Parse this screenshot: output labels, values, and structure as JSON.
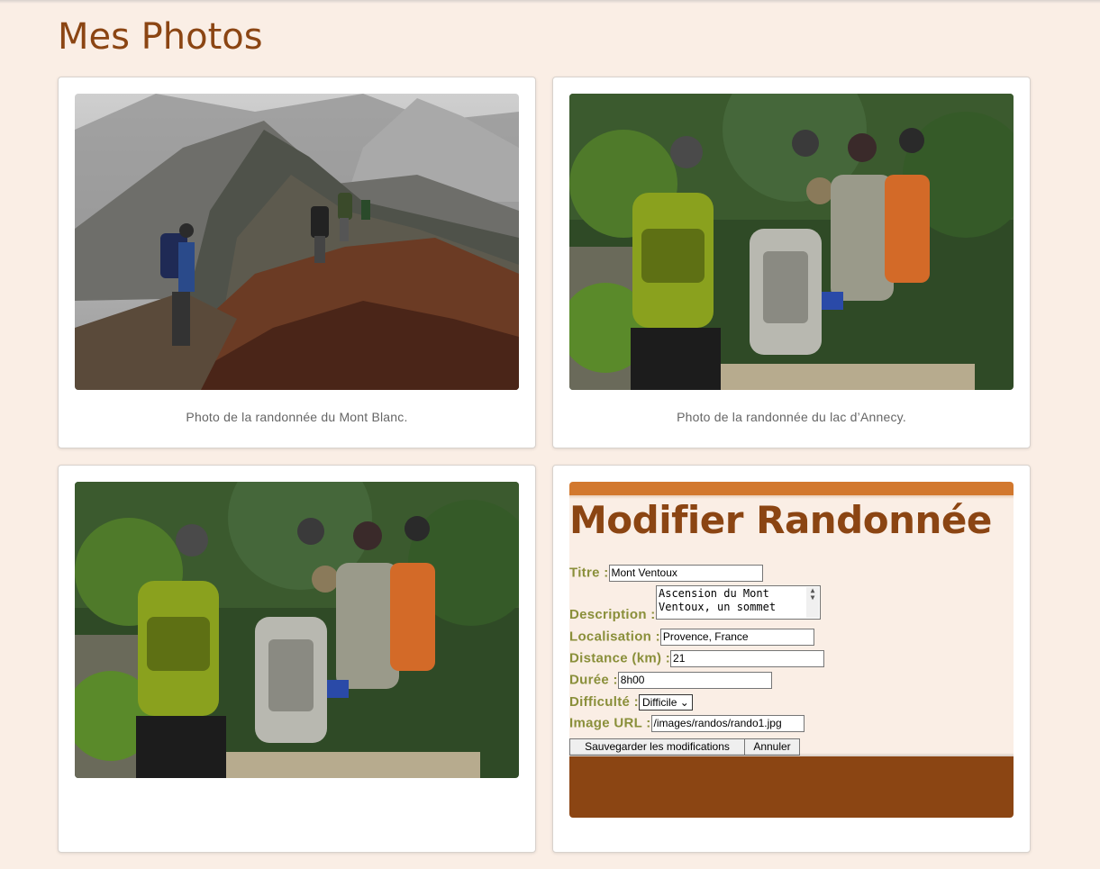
{
  "page": {
    "title": "Mes Photos"
  },
  "cards": [
    {
      "caption": "Photo de la randonnée du Mont Blanc."
    },
    {
      "caption": "Photo de la randonnée du lac d’Annecy."
    },
    {
      "caption": ""
    }
  ],
  "edit_form": {
    "title": "Modifier Randonnée",
    "fields": {
      "titre": {
        "label": "Titre :",
        "value": "Mont Ventoux"
      },
      "description": {
        "label": "Description :",
        "value": "Ascension du Mont Ventoux, un sommet"
      },
      "localisation": {
        "label": "Localisation :",
        "value": "Provence, France"
      },
      "distance": {
        "label": "Distance (km) :",
        "value": "21"
      },
      "duree": {
        "label": "Durée :",
        "value": "8h00"
      },
      "difficulte": {
        "label": "Difficulté :",
        "value": "Difficile"
      },
      "image_url": {
        "label": "Image URL :",
        "value": "/images/randos/rando1.jpg"
      }
    },
    "save_label": "Sauvegarder les modifications",
    "cancel_label": "Annuler"
  },
  "colors": {
    "background": "#faeee5",
    "title": "#8b4513",
    "label": "#8a8f3a",
    "accent_bar": "#d2782e",
    "footer": "#8b4513"
  }
}
